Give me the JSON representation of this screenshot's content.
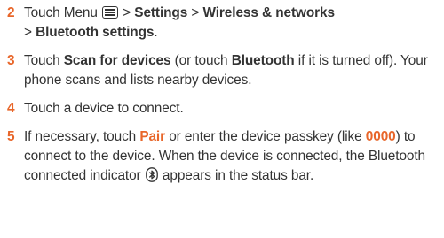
{
  "steps": [
    {
      "num": "2",
      "p1": "Touch Menu ",
      "menu_icon": "menu-icon",
      "p2": " > ",
      "b1": "Settings",
      "p3": " > ",
      "b2": "Wireless & networks",
      "p4": " > ",
      "b3": "Bluetooth settings",
      "p5": "."
    },
    {
      "num": "3",
      "p1": "Touch ",
      "b1": "Scan for devices",
      "p2": " (or touch ",
      "b2": "Bluetooth",
      "p3": " if it is turned off). Your phone scans and lists nearby devices."
    },
    {
      "num": "4",
      "p1": "Touch a device to connect."
    },
    {
      "num": "5",
      "p1": "If necessary, touch ",
      "o1": "Pair",
      "p2": " or enter the device passkey (like ",
      "o2": "0000",
      "p3": ") to connect to the device. When the device is connected, the Bluetooth connected indicator ",
      "bt_icon": "bluetooth-connected-icon",
      "p4": " appears in the status bar."
    }
  ],
  "colors": {
    "accent": "#e8662a",
    "text": "#333333"
  }
}
